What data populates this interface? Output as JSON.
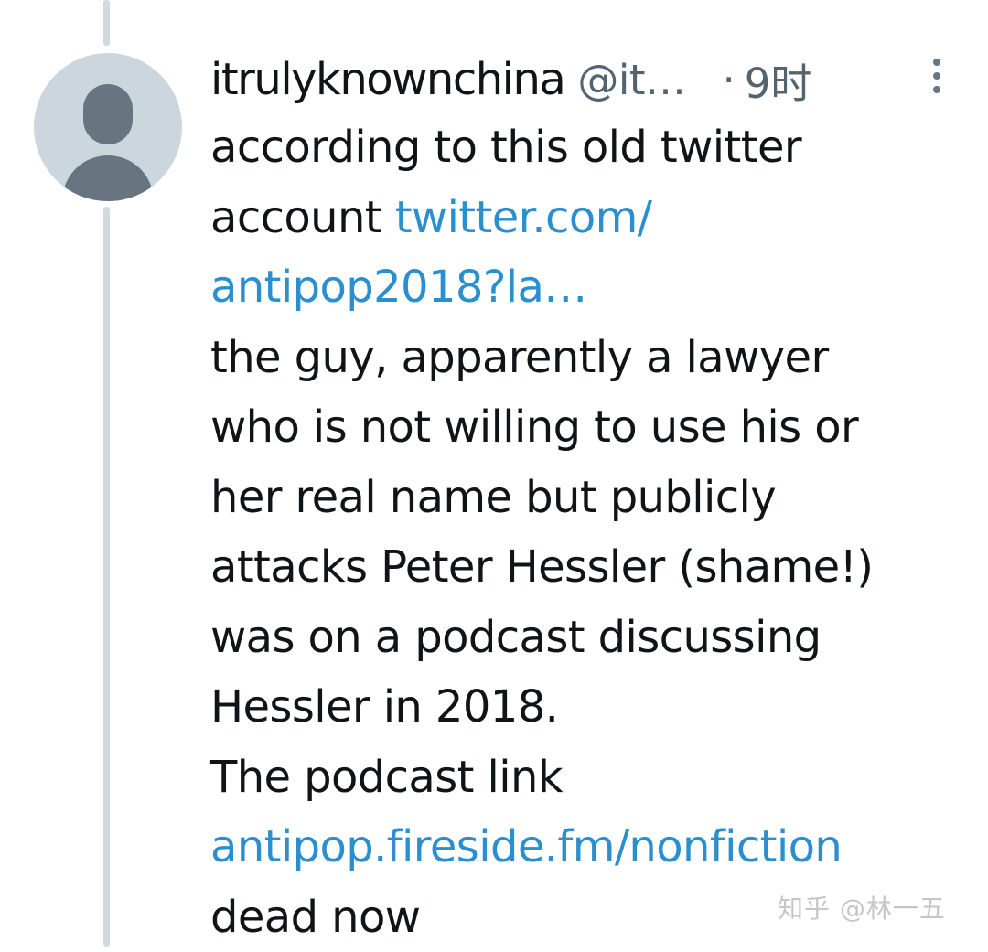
{
  "tweet": {
    "author": {
      "display_name": "itrulyknownchina",
      "handle": "@it…"
    },
    "separator": "·",
    "timestamp": "9时",
    "body": {
      "line1": "according to this old twitter",
      "line2_text": "account ",
      "link1_part1": "twitter.com/",
      "link1_part2": "antipop2018?la…",
      "line4": "the guy, apparently a lawyer",
      "line5": "who is not willing to use his or",
      "line6": "her real name but publicly",
      "line7": "attacks Peter Hessler (shame!)",
      "line8": "was on a podcast discussing",
      "line9": "Hessler in 2018.",
      "line10": "The podcast link",
      "link2": "antipop.fireside.fm/nonfiction",
      "line12": "dead now"
    }
  },
  "icons": {
    "avatar": "default-avatar-icon",
    "menu": "more-options-icon"
  },
  "watermark": {
    "text": "知乎 @林一五"
  },
  "colors": {
    "link": "#2b8fcf",
    "secondary_text": "#536471",
    "thread_line": "#cfd9de",
    "avatar_bg": "#ccd6dd",
    "avatar_fg": "#66757f"
  }
}
